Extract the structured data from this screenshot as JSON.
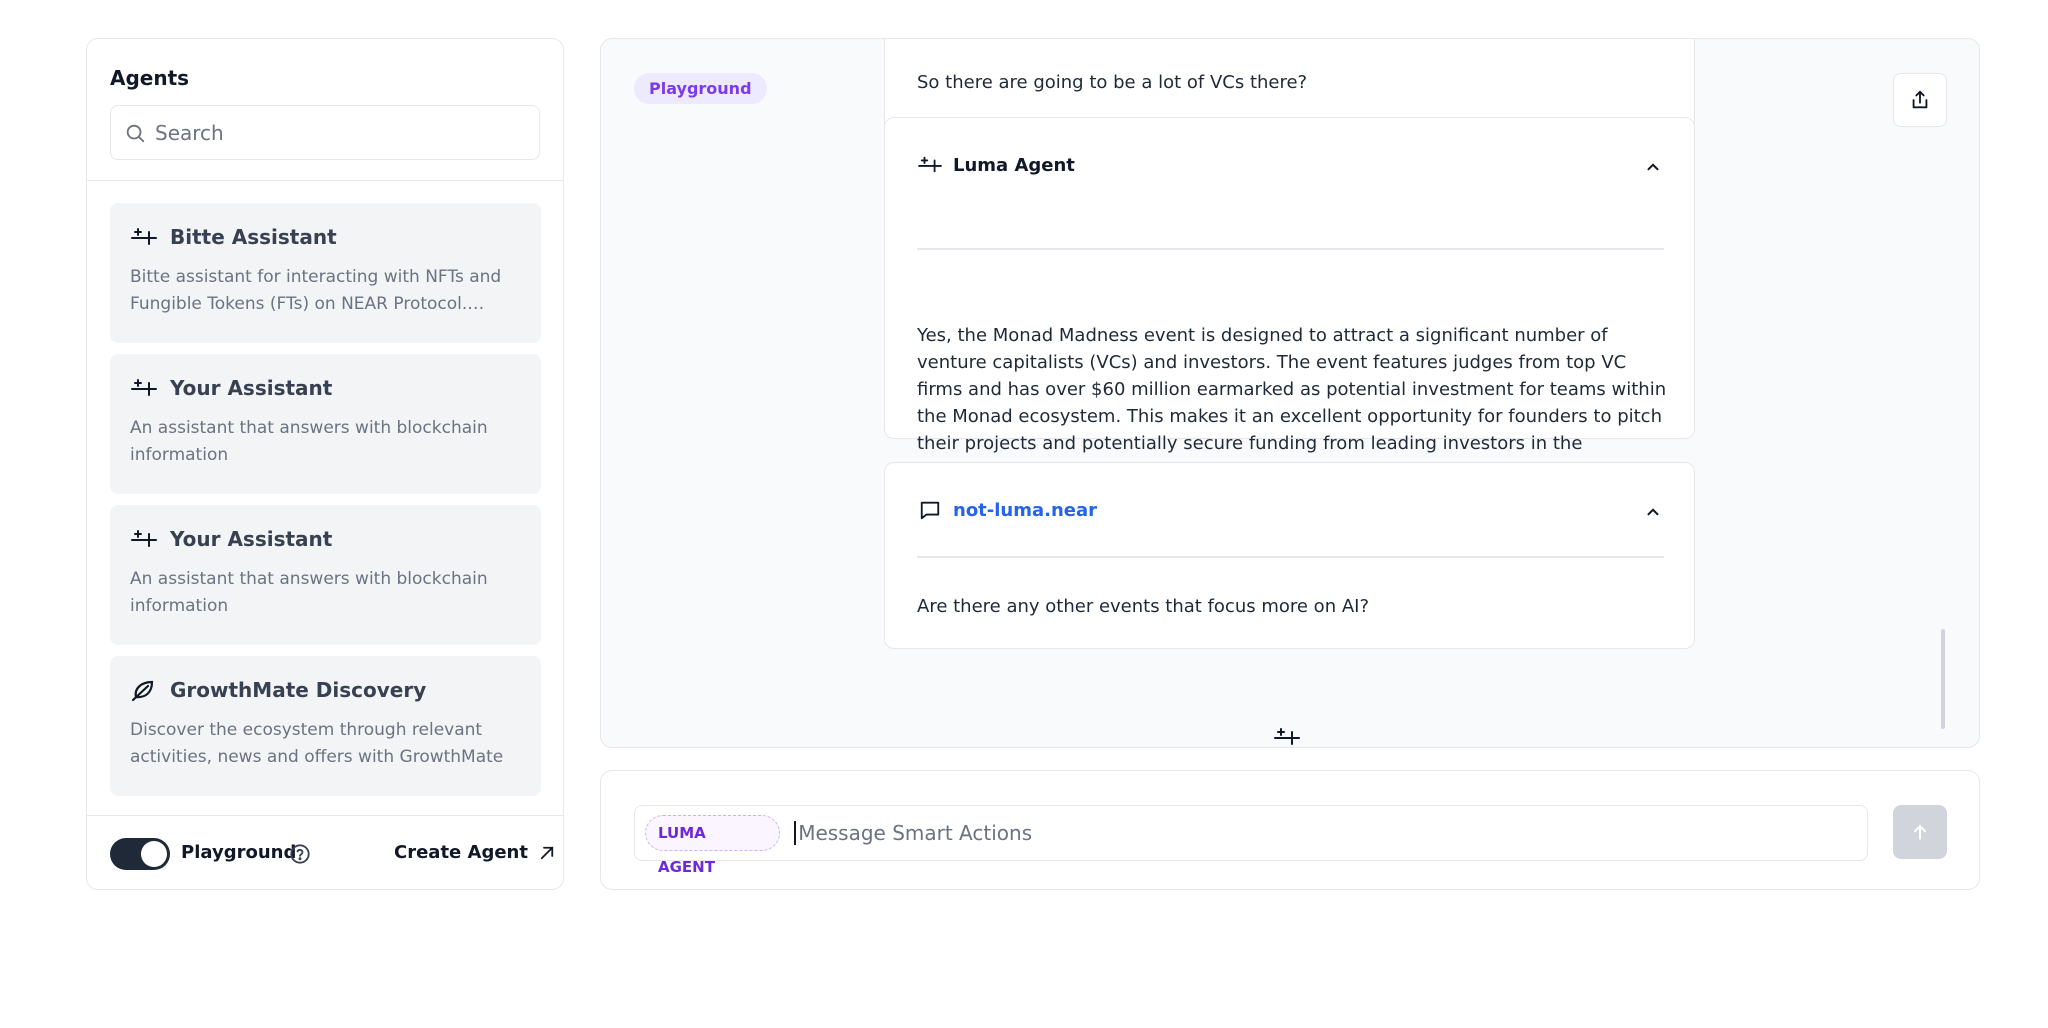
{
  "sidebar": {
    "title": "Agents",
    "search_placeholder": "Search",
    "agents": [
      {
        "name": "Bitte Assistant",
        "description": "Bitte assistant for interacting with NFTs and Fungible Tokens (FTs) on NEAR Protocol.…",
        "icon": "sparkle-icon"
      },
      {
        "name": "Your Assistant",
        "description": "An assistant that answers with blockchain information",
        "icon": "sparkle-icon"
      },
      {
        "name": "Your Assistant",
        "description": "An assistant that answers with blockchain information",
        "icon": "sparkle-icon"
      },
      {
        "name": "GrowthMate Discovery",
        "description": "Discover the ecosystem through relevant activities, news and offers with GrowthMate",
        "icon": "leaf-icon"
      }
    ],
    "playground_label": "Playground",
    "playground_enabled": true,
    "create_agent_label": "Create Agent"
  },
  "chat": {
    "badge": "Playground",
    "messages": [
      {
        "text": "So there are going to be a lot of VCs there?"
      },
      {
        "author": "Luma Agent",
        "text": "Yes, the Monad Madness event is designed to attract a significant number of venture capitalists (VCs) and investors. The event features judges from top VC firms and has over $60 million earmarked as potential investment for teams within the Monad ecosystem. This makes it an excellent opportunity for founders to pitch their projects and potentially secure funding from leading investors in the blockchain and crypto space."
      },
      {
        "author": "not-luma.near",
        "text": "Are there any other events that focus more on AI?"
      }
    ]
  },
  "composer": {
    "agent_chip": "LUMA AGENT",
    "placeholder": "Message Smart Actions"
  },
  "colors": {
    "accent": "#7c3aed",
    "link": "#2563eb",
    "toggle": "#1f2937"
  }
}
